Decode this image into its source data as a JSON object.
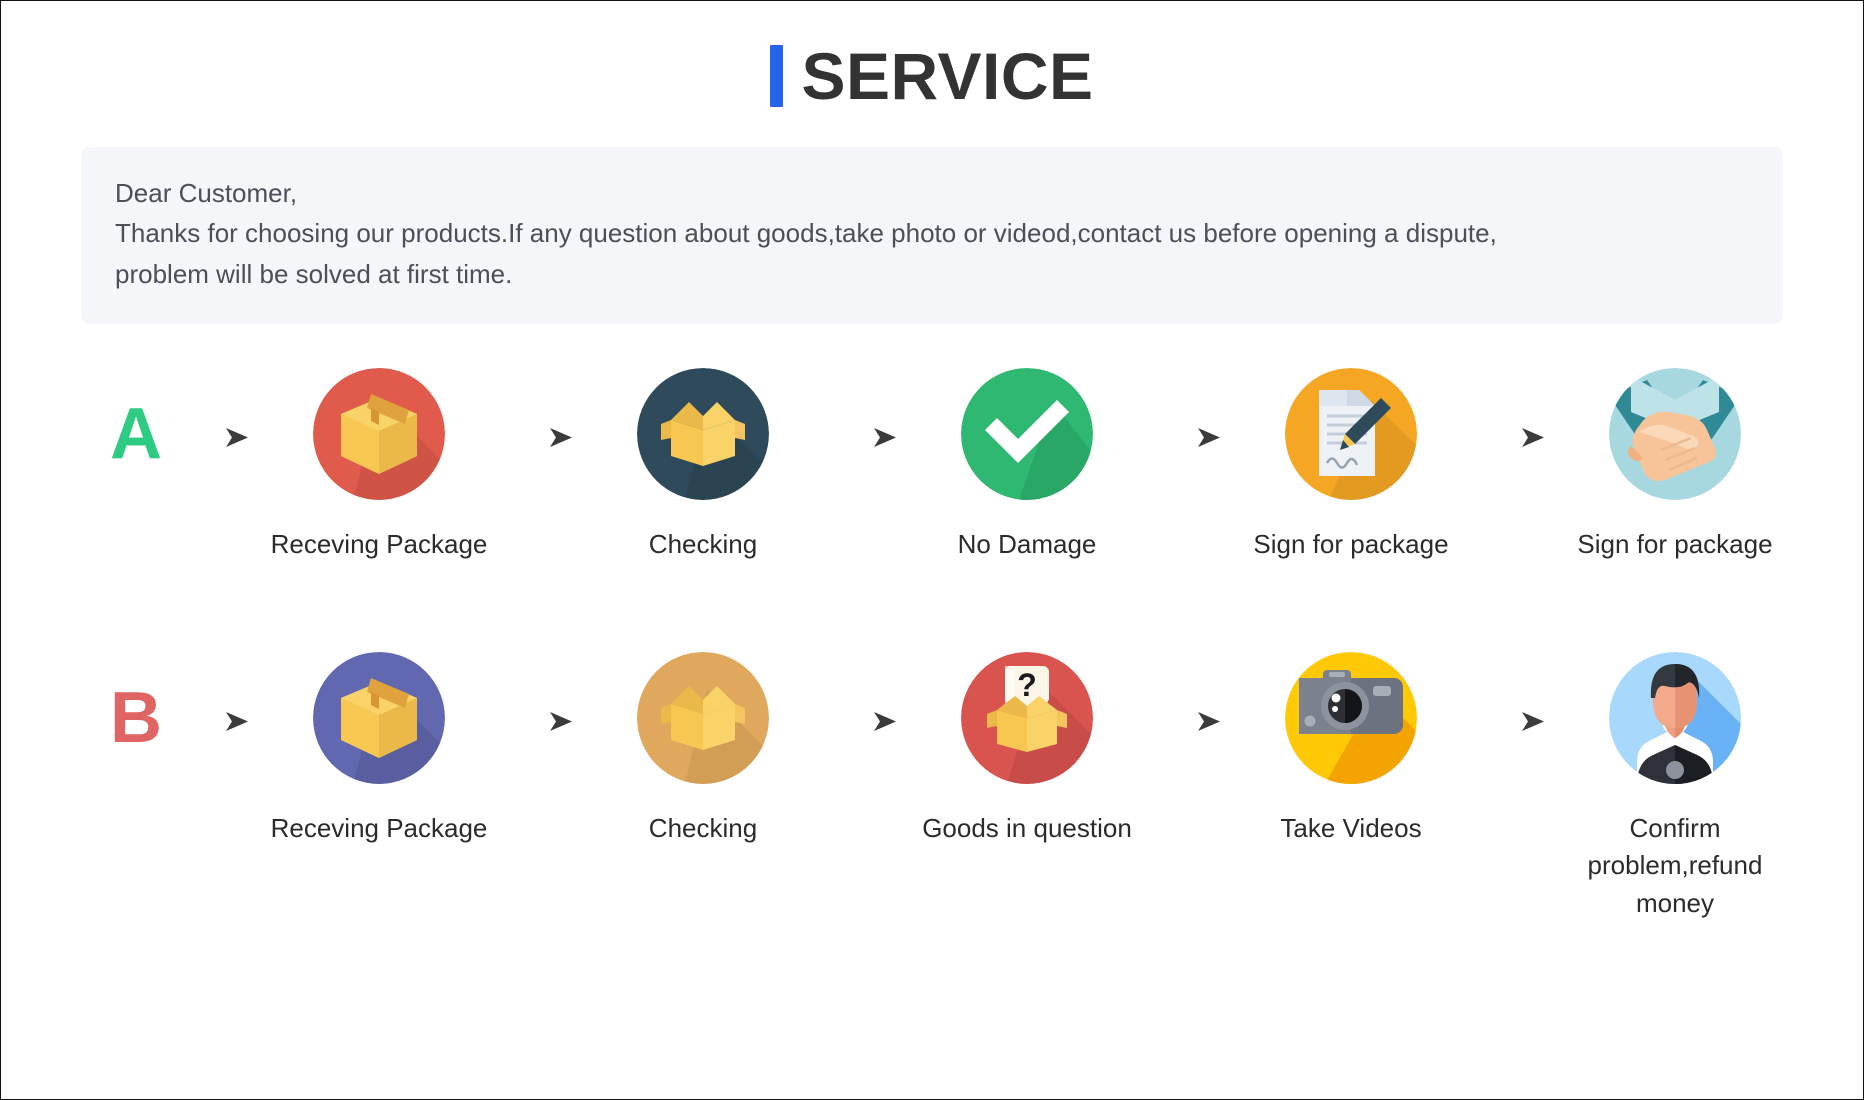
{
  "header": {
    "accent_color": "#2563eb",
    "title": "SERVICE"
  },
  "notice": {
    "line1": "Dear Customer,",
    "line2": "Thanks for choosing our products.If any question about goods,take photo or videod,contact us before opening a dispute,",
    "line3": "problem will be solved at first time.",
    "background_color": "#f4f6fa"
  },
  "flows": [
    {
      "letter": "A",
      "letter_color": "#2ecc82",
      "steps": [
        {
          "icon": "closed-box-icon",
          "label": "Receving Package",
          "circle_color": "#e05b4c"
        },
        {
          "icon": "open-box-icon",
          "label": "Checking",
          "circle_color": "#2f4a5a"
        },
        {
          "icon": "checkmark-icon",
          "label": "No Damage",
          "circle_color": "#2eb872"
        },
        {
          "icon": "signed-document-icon",
          "label": "Sign for package",
          "circle_color": "#f5a623"
        },
        {
          "icon": "handshake-icon",
          "label": "Sign for package",
          "circle_color": "#a7d8e0"
        }
      ]
    },
    {
      "letter": "B",
      "letter_color": "#e06464",
      "steps": [
        {
          "icon": "closed-box-icon",
          "label": "Receving Package",
          "circle_color": "#6168b0"
        },
        {
          "icon": "open-box-icon",
          "label": "Checking",
          "circle_color": "#e0a85c"
        },
        {
          "icon": "question-box-icon",
          "label": "Goods in question",
          "circle_color": "#d9534f"
        },
        {
          "icon": "camera-icon",
          "label": "Take Videos",
          "circle_color": "#ffc907"
        },
        {
          "icon": "support-agent-icon",
          "label": "Confirm problem,refund money",
          "circle_color": "#a8d8fb"
        }
      ]
    }
  ],
  "arrow": {
    "name": "arrow-right-icon",
    "color": "#3b3b3b"
  }
}
